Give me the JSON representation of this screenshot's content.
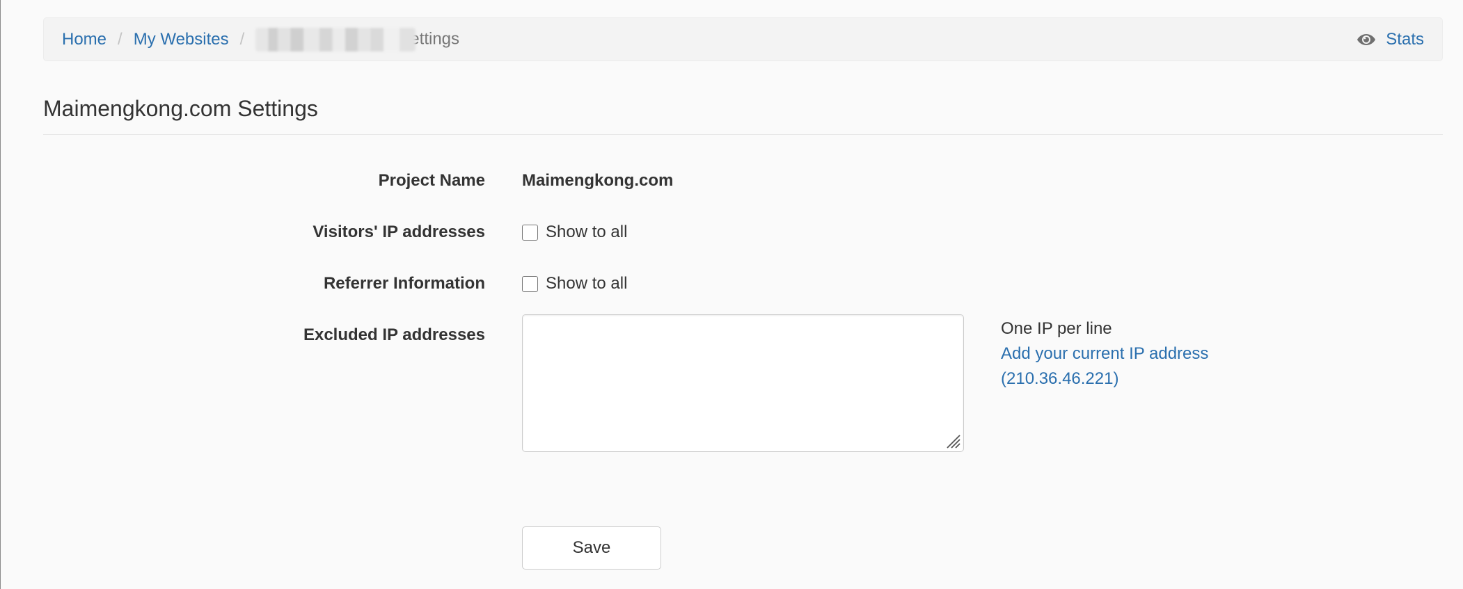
{
  "breadcrumb": {
    "items": [
      {
        "label": "Home"
      },
      {
        "label": "My Websites"
      }
    ],
    "separator": "/",
    "current_suffix": "ettings",
    "stats_label": "Stats",
    "stats_icon": "eye-icon"
  },
  "page": {
    "title": "Maimengkong.com Settings"
  },
  "form": {
    "project_name": {
      "label": "Project Name",
      "value": "Maimengkong.com"
    },
    "visitors_ip": {
      "label": "Visitors' IP addresses",
      "checkbox_label": "Show to all",
      "checked": false
    },
    "referrer": {
      "label": "Referrer Information",
      "checkbox_label": "Show to all",
      "checked": false
    },
    "excluded_ips": {
      "label": "Excluded IP addresses",
      "value": "",
      "help_text": "One IP per line",
      "add_link_label": "Add your current IP address",
      "current_ip": "(210.36.46.221)"
    },
    "save_label": "Save"
  },
  "colors": {
    "link": "#2a6fae",
    "background": "#fafafa",
    "breadcrumb_bg": "#f3f3f3",
    "text": "#333333"
  }
}
